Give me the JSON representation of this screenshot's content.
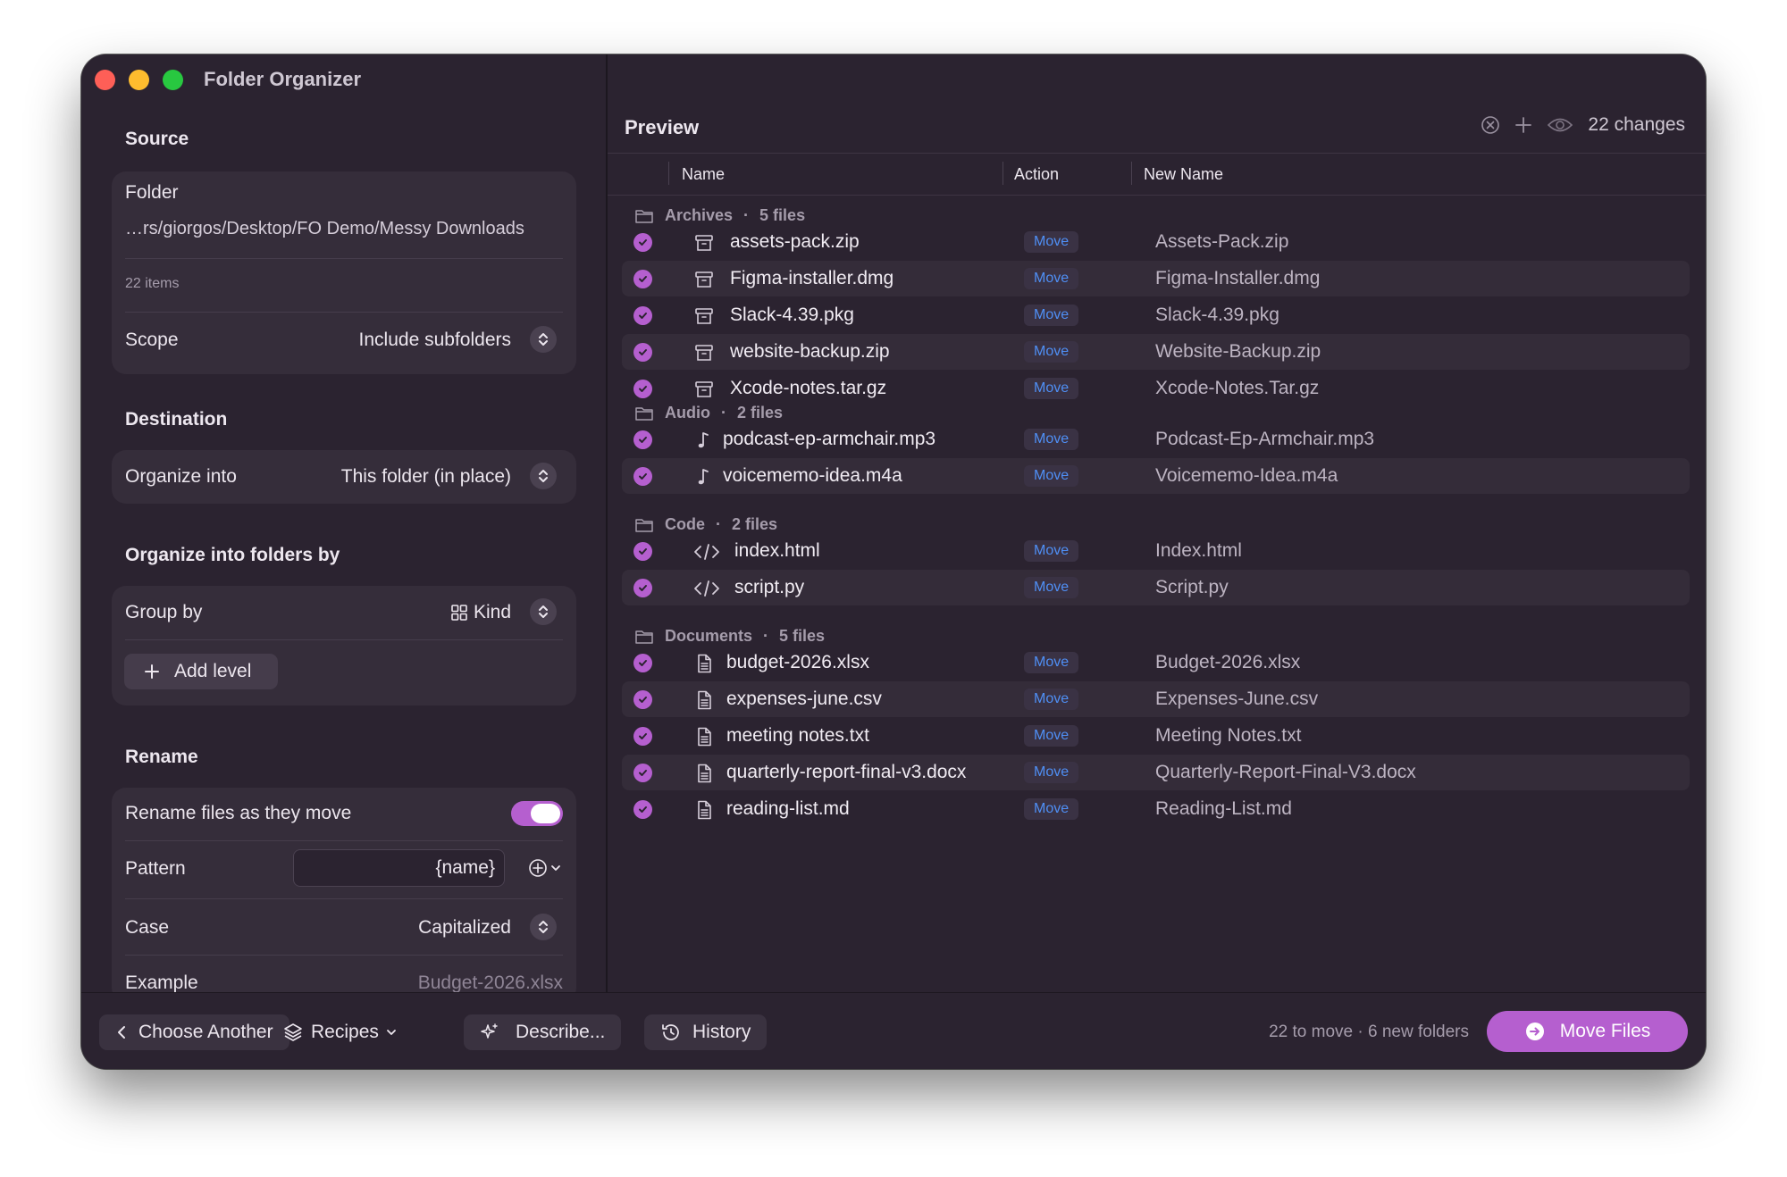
{
  "window": {
    "title": "Folder Organizer"
  },
  "sidebar": {
    "source": {
      "title": "Source",
      "folder_label": "Folder",
      "folder_path": "…rs/giorgos/Desktop/FO Demo/Messy Downloads",
      "item_count": "22 items",
      "scope_label": "Scope",
      "scope_value": "Include subfolders"
    },
    "destination": {
      "title": "Destination",
      "organize_label": "Organize into",
      "organize_value": "This folder (in place)"
    },
    "grouping": {
      "title": "Organize into folders by",
      "group_label": "Group by",
      "group_value": "Kind",
      "add_level": "Add level"
    },
    "rename": {
      "title": "Rename",
      "toggle_label": "Rename files as they move",
      "toggle_on": true,
      "pattern_label": "Pattern",
      "pattern_value": "{name}",
      "case_label": "Case",
      "case_value": "Capitalized",
      "example_label": "Example",
      "example_value": "Budget-2026.xlsx"
    }
  },
  "preview": {
    "title": "Preview",
    "changes": "22 changes",
    "columns": {
      "name": "Name",
      "action": "Action",
      "new_name": "New Name"
    },
    "groups": [
      {
        "name": "Archives",
        "count": "5 files",
        "icon": "archive-icon",
        "files": [
          {
            "name": "assets-pack.zip",
            "action": "Move",
            "new_name": "Assets-Pack.zip"
          },
          {
            "name": "Figma-installer.dmg",
            "action": "Move",
            "new_name": "Figma-Installer.dmg"
          },
          {
            "name": "Slack-4.39.pkg",
            "action": "Move",
            "new_name": "Slack-4.39.pkg"
          },
          {
            "name": "website-backup.zip",
            "action": "Move",
            "new_name": "Website-Backup.zip"
          },
          {
            "name": "Xcode-notes.tar.gz",
            "action": "Move",
            "new_name": "Xcode-Notes.Tar.gz"
          }
        ]
      },
      {
        "name": "Audio",
        "count": "2 files",
        "icon": "music-note-icon",
        "files": [
          {
            "name": "podcast-ep-armchair.mp3",
            "action": "Move",
            "new_name": "Podcast-Ep-Armchair.mp3"
          },
          {
            "name": "voicememo-idea.m4a",
            "action": "Move",
            "new_name": "Voicememo-Idea.m4a"
          }
        ]
      },
      {
        "name": "Code",
        "count": "2 files",
        "icon": "code-icon",
        "files": [
          {
            "name": "index.html",
            "action": "Move",
            "new_name": "Index.html"
          },
          {
            "name": "script.py",
            "action": "Move",
            "new_name": "Script.py"
          }
        ]
      },
      {
        "name": "Documents",
        "count": "5 files",
        "icon": "document-icon",
        "files": [
          {
            "name": "budget-2026.xlsx",
            "action": "Move",
            "new_name": "Budget-2026.xlsx"
          },
          {
            "name": "expenses-june.csv",
            "action": "Move",
            "new_name": "Expenses-June.csv"
          },
          {
            "name": "meeting notes.txt",
            "action": "Move",
            "new_name": "Meeting Notes.txt"
          },
          {
            "name": "quarterly-report-final-v3.docx",
            "action": "Move",
            "new_name": "Quarterly-Report-Final-V3.docx"
          },
          {
            "name": "reading-list.md",
            "action": "Move",
            "new_name": "Reading-List.md"
          }
        ]
      }
    ]
  },
  "bottom_bar": {
    "choose_another": "Choose Another",
    "recipes": "Recipes",
    "describe": "Describe...",
    "history": "History",
    "status": "22 to move · 6 new folders",
    "primary": "Move Files"
  },
  "colors": {
    "accent": "#b55fcf",
    "move_badge_text": "#4f8ff5",
    "background": "#2b2330"
  }
}
